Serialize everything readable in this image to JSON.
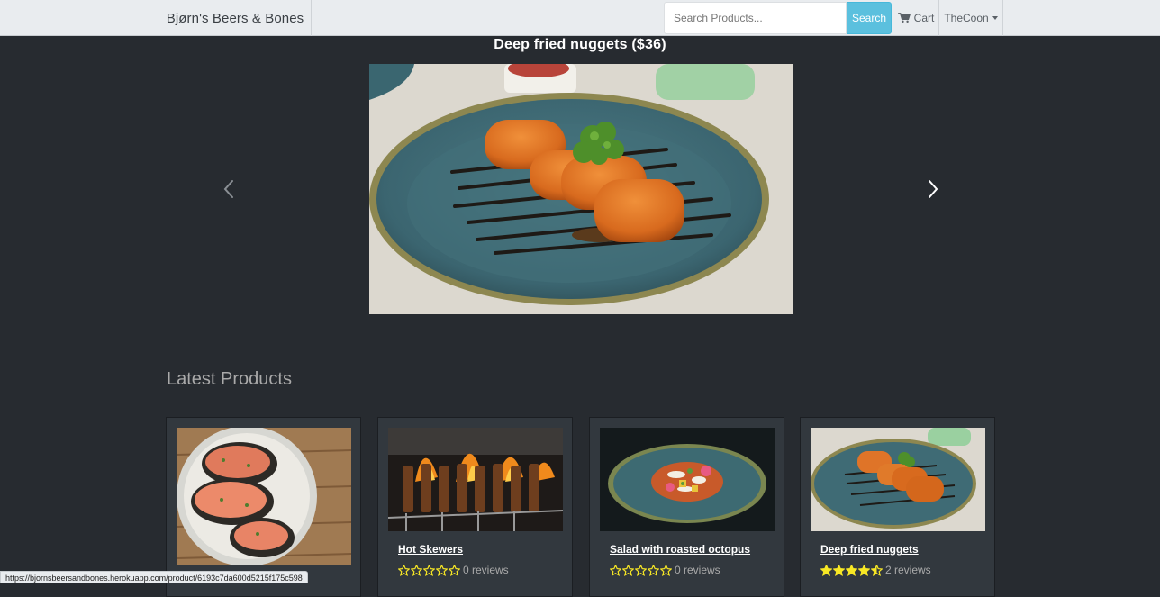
{
  "navbar": {
    "brand": "Bjørn's Beers & Bones",
    "search_placeholder": "Search Products...",
    "search_button": "Search",
    "cart_label": "Cart",
    "cart_icon": "shopping-cart-icon",
    "user_label": "TheCoon"
  },
  "carousel": {
    "caption": "Deep fried nuggets ($36)",
    "prev_icon": "chevron-left-icon",
    "next_icon": "chevron-right-icon"
  },
  "latest": {
    "title": "Latest Products",
    "products": [
      {
        "name": "",
        "rating": 0,
        "reviews": ""
      },
      {
        "name": "Hot Skewers",
        "rating": 0,
        "reviews": "0 reviews"
      },
      {
        "name": "Salad with roasted octopus",
        "rating": 0,
        "reviews": "0 reviews"
      },
      {
        "name": "Deep fried nuggets",
        "rating": 4.5,
        "reviews": "2 reviews"
      }
    ]
  },
  "status_url": "https://bjornsbeersandbones.herokuapp.com/product/6193c7da600d5215f175c598",
  "colors": {
    "navbar": "#e9ecef",
    "background": "#272b30",
    "card": "#32383e",
    "accent": "#5bc0de",
    "star": "#f8e825"
  }
}
